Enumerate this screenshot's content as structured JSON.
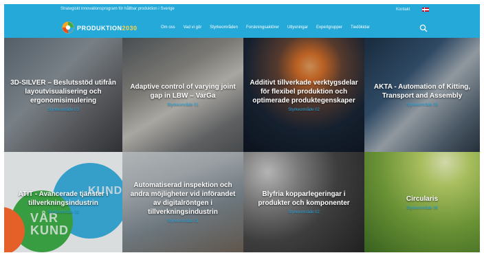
{
  "header": {
    "tagline": "Strategiskt innovationsprogram för hållbar produktion i Sverige",
    "contact": "Kontakt",
    "logo_text": "PRODUKTION",
    "logo_year": "2030",
    "nav": [
      "Om oss",
      "Vad vi gör",
      "Styrkeområden",
      "Forskningsaktörer",
      "Utlysningar",
      "Expertgrupper",
      "Tiedökidar"
    ]
  },
  "tiles": [
    {
      "title": "3D-SILVER – Beslutsstöd utifrån layoutvisualisering och ergonomisimulering",
      "tag": "Styrkeområde 03"
    },
    {
      "title": "Adaptive control of varying joint gap in LBW – VarGa",
      "tag": "Styrkeområde 01"
    },
    {
      "title": "Additivt tillverkade verktygsdelar för flexibel produktion och optimerade produktegenskaper",
      "tag": "Styrkeområde 02"
    },
    {
      "title": "AKTA - Automation of Kitting, Transport and Assembly",
      "tag": "Styrkeområde 03"
    },
    {
      "title": "ATIT - Avancerade tjänster i tillverkningsindustrin",
      "tag": "Styrkeområde 03",
      "bg_words": [
        "VÅR",
        "KUND",
        "KUND"
      ]
    },
    {
      "title": "Automatiserad inspektion och andra möjligheter vid införandet av digitalröntgen i tillverkningsindustrin",
      "tag": "Styrkeområde 01"
    },
    {
      "title": "Blyfria kopparlegeringar i produkter och komponenter",
      "tag": "Styrkeområde 02"
    },
    {
      "title": "Circularis",
      "tag": "Styrkeområde 06"
    }
  ],
  "colors": {
    "header": "#25a9d8",
    "tag": "#2aa8e0"
  }
}
